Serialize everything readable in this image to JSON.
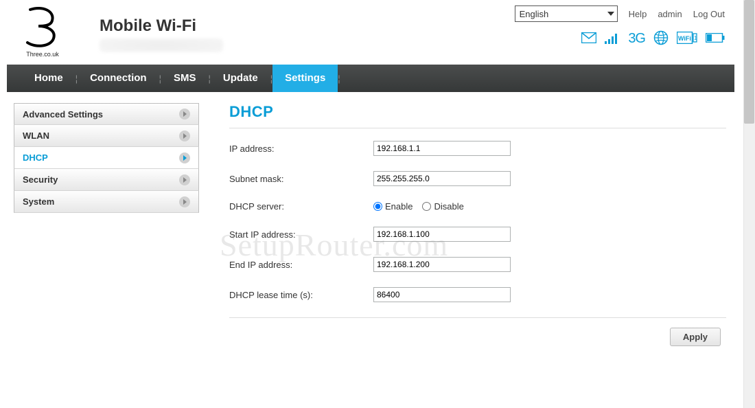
{
  "header": {
    "brand_title": "Mobile Wi-Fi",
    "logo_subtext": "Three.co.uk",
    "language": "English",
    "links": {
      "help": "Help",
      "user": "admin",
      "logout": "Log Out"
    },
    "status": {
      "network_label": "3G"
    }
  },
  "nav": {
    "items": [
      "Home",
      "Connection",
      "SMS",
      "Update",
      "Settings"
    ],
    "active_index": 4
  },
  "sidebar": {
    "items": [
      {
        "label": "Advanced Settings",
        "active": false
      },
      {
        "label": "WLAN",
        "active": false
      },
      {
        "label": "DHCP",
        "active": true
      },
      {
        "label": "Security",
        "active": false
      },
      {
        "label": "System",
        "active": false
      }
    ]
  },
  "page": {
    "title": "DHCP",
    "fields": {
      "ip_address": {
        "label": "IP address:",
        "value": "192.168.1.1"
      },
      "subnet_mask": {
        "label": "Subnet mask:",
        "value": "255.255.255.0"
      },
      "dhcp_server": {
        "label": "DHCP server:",
        "option_enable": "Enable",
        "option_disable": "Disable",
        "selected": "enable"
      },
      "start_ip": {
        "label": "Start IP address:",
        "value": "192.168.1.100"
      },
      "end_ip": {
        "label": "End IP address:",
        "value": "192.168.1.200"
      },
      "lease_time": {
        "label": "DHCP lease time (s):",
        "value": "86400"
      }
    },
    "apply": "Apply"
  },
  "watermark": "SetupRouter.com"
}
